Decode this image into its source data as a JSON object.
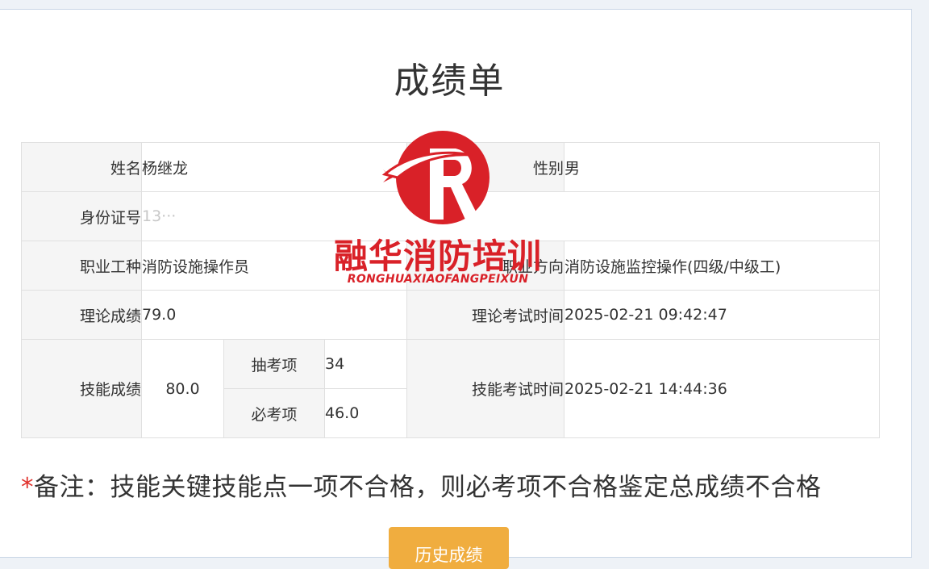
{
  "page": {
    "title": "成绩单"
  },
  "table": {
    "name_label": "姓名",
    "name_value": "杨继龙",
    "gender_label": "性别",
    "gender_value": "男",
    "id_label": "身份证号",
    "id_value": "13···",
    "occupation_label": "职业工种",
    "occupation_value": "消防设施操作员",
    "direction_label": "职业方向",
    "direction_value": "消防设施监控操作(四级/中级工)",
    "theory_label": "理论成绩",
    "theory_value": "79.0",
    "theory_time_label": "理论考试时间",
    "theory_time_value": "2025-02-21 09:42:47",
    "skill_label": "技能成绩",
    "skill_value": "80.0",
    "random_label": "抽考项",
    "random_value": "34",
    "required_label": "必考项",
    "required_value": "46.0",
    "skill_time_label": "技能考试时间",
    "skill_time_value": "2025-02-21 14:44:36"
  },
  "note": {
    "star": "*",
    "text": "备注：技能关键技能点一项不合格，则必考项不合格鉴定总成绩不合格"
  },
  "history_button": {
    "label": "历史成绩"
  },
  "watermark": {
    "name_cn": "融华消防培训",
    "name_en": "RONGHUAXIAOFANGPEIXUN",
    "logo_icon": "r-swoosh-logo-icon"
  },
  "colors": {
    "accent": "#f0ad3f",
    "score": "#4da6c4",
    "required_star": "#e0302b",
    "watermark_red": "#d92128"
  }
}
